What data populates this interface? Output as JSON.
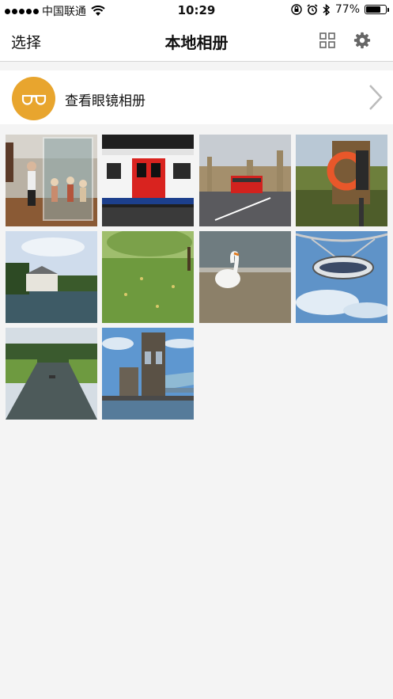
{
  "status_bar": {
    "carrier": "中国联通",
    "time": "10:29",
    "battery_percent": "77%",
    "battery_level": 0.77,
    "icons": [
      "signal-dots-icon",
      "wifi-icon",
      "orientation-lock-icon",
      "alarm-icon",
      "bluetooth-icon",
      "battery-icon"
    ]
  },
  "navbar": {
    "left_button": "选择",
    "title": "本地相册",
    "right_icons": [
      "grid-view-icon",
      "gear-icon"
    ]
  },
  "glasses_album": {
    "label": "查看眼镜相册",
    "icon": "glasses-icon",
    "accent_color": "#e8a52e",
    "chevron": "chevron-right-icon"
  },
  "photos": [
    {
      "subject": "museum-display"
    },
    {
      "subject": "underground-train"
    },
    {
      "subject": "westminster-bus"
    },
    {
      "subject": "lifebuoy"
    },
    {
      "subject": "riverside-house"
    },
    {
      "subject": "park-lawn"
    },
    {
      "subject": "swan"
    },
    {
      "subject": "london-eye-capsule"
    },
    {
      "subject": "river-punting"
    },
    {
      "subject": "tower-bridge"
    }
  ]
}
